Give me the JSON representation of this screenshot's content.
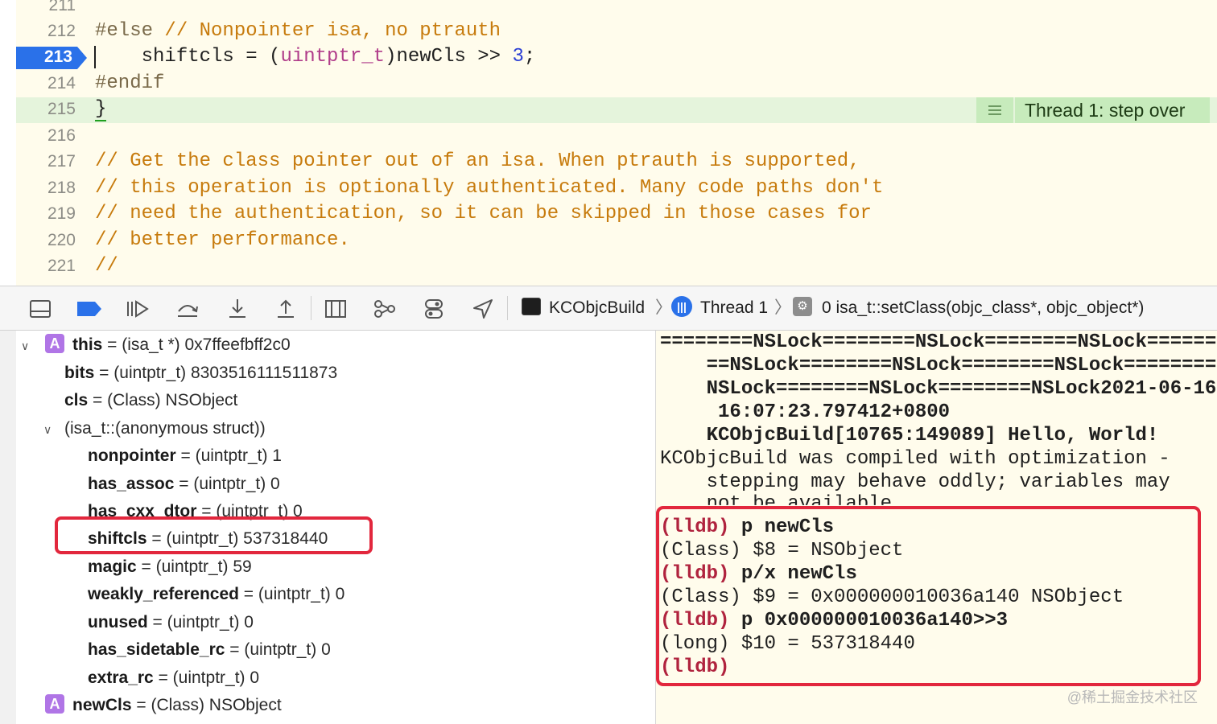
{
  "editor": {
    "lines": [
      {
        "num": "211",
        "code": ""
      },
      {
        "num": "212",
        "pre": "#else",
        "comment": " // Nonpointer isa, no ptrauth"
      },
      {
        "num": "213",
        "code_a": "    shiftcls = (",
        "type": "uintptr_t",
        "code_b": ")newCls >> ",
        "number": "3",
        "code_c": ";"
      },
      {
        "num": "214",
        "pre": "#endif"
      },
      {
        "num": "215",
        "brace": "}"
      },
      {
        "num": "216",
        "code": ""
      },
      {
        "num": "217",
        "comment": "// Get the class pointer out of an isa. When ptrauth is supported,"
      },
      {
        "num": "218",
        "comment": "// this operation is optionally authenticated. Many code paths don't"
      },
      {
        "num": "219",
        "comment": "// need the authentication, so it can be skipped in those cases for"
      },
      {
        "num": "220",
        "comment": "// better performance."
      },
      {
        "num": "221",
        "comment": "//"
      }
    ],
    "thread_badge": {
      "icon": "list-icon",
      "text": "Thread 1: step over"
    }
  },
  "toolbar": {
    "buttons": [
      "hide-debug-area-icon",
      "breakpoint-toggle-icon",
      "continue-icon",
      "step-over-icon",
      "step-into-icon",
      "step-out-icon",
      "view-hierarchy-icon",
      "memory-graph-icon",
      "environment-overrides-icon",
      "location-icon"
    ],
    "breadcrumbs": {
      "target": "KCObjcBuild",
      "thread": "Thread 1",
      "frame": "0 isa_t::setClass(objc_class*, objc_object*)"
    }
  },
  "variables": {
    "rows": [
      {
        "name": "this",
        "rest": " = (isa_t *) 0x7ffeefbff2c0",
        "badge": "A"
      },
      {
        "name": "bits",
        "rest": " = (uintptr_t) 8303516111511873"
      },
      {
        "name": "cls",
        "rest": " = (Class) NSObject"
      },
      {
        "name": "",
        "rest": "(isa_t::(anonymous struct))"
      },
      {
        "name": "nonpointer",
        "rest": " = (uintptr_t) 1"
      },
      {
        "name": "has_assoc",
        "rest": " = (uintptr_t) 0"
      },
      {
        "name": "has_cxx_dtor",
        "rest": " = (uintptr_t) 0"
      },
      {
        "name": "shiftcls",
        "rest": " = (uintptr_t) 537318440"
      },
      {
        "name": "magic",
        "rest": " = (uintptr_t) 59"
      },
      {
        "name": "weakly_referenced",
        "rest": " = (uintptr_t) 0"
      },
      {
        "name": "unused",
        "rest": " = (uintptr_t) 0"
      },
      {
        "name": "has_sidetable_rc",
        "rest": " = (uintptr_t) 0"
      },
      {
        "name": "extra_rc",
        "rest": " = (uintptr_t) 0"
      },
      {
        "name": "newCls",
        "rest": " = (Class) NSObject",
        "badge": "A"
      }
    ]
  },
  "console": {
    "lines": [
      "========NSLock========NSLock========NSLock======",
      "    ==NSLock========NSLock========NSLock========",
      "    NSLock========NSLock========NSLock2021-06-16",
      "     16:07:23.797412+0800",
      "    KCObjcBuild[10765:149089] Hello, World!",
      "KCObjcBuild was compiled with optimization -",
      "    stepping may behave oddly; variables may",
      "    not be available."
    ],
    "prompt": "(lldb)",
    "cmd1": " p newCls",
    "out1": "(Class) $8 = NSObject",
    "cmd2": " p/x newCls",
    "out2": "(Class) $9 = 0x000000010036a140 NSObject",
    "cmd3": " p 0x000000010036a140>>3",
    "out3": "(long) $10 = 537318440",
    "watermark": "@稀土掘金技术社区"
  }
}
